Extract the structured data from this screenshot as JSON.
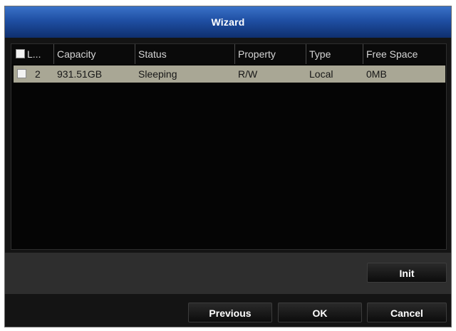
{
  "window": {
    "title": "Wizard"
  },
  "table": {
    "headers": [
      "L...",
      "Capacity",
      "Status",
      "Property",
      "Type",
      "Free Space"
    ],
    "rows": [
      {
        "label": "2",
        "capacity": "931.51GB",
        "status": "Sleeping",
        "property": "R/W",
        "type": "Local",
        "free_space": "0MB",
        "checked": false
      }
    ]
  },
  "buttons": {
    "init": "Init",
    "previous": "Previous",
    "ok": "OK",
    "cancel": "Cancel"
  },
  "colors": {
    "titlebar": "#1f4fa3",
    "selected_row": "#a9a795",
    "background": "#141414"
  }
}
